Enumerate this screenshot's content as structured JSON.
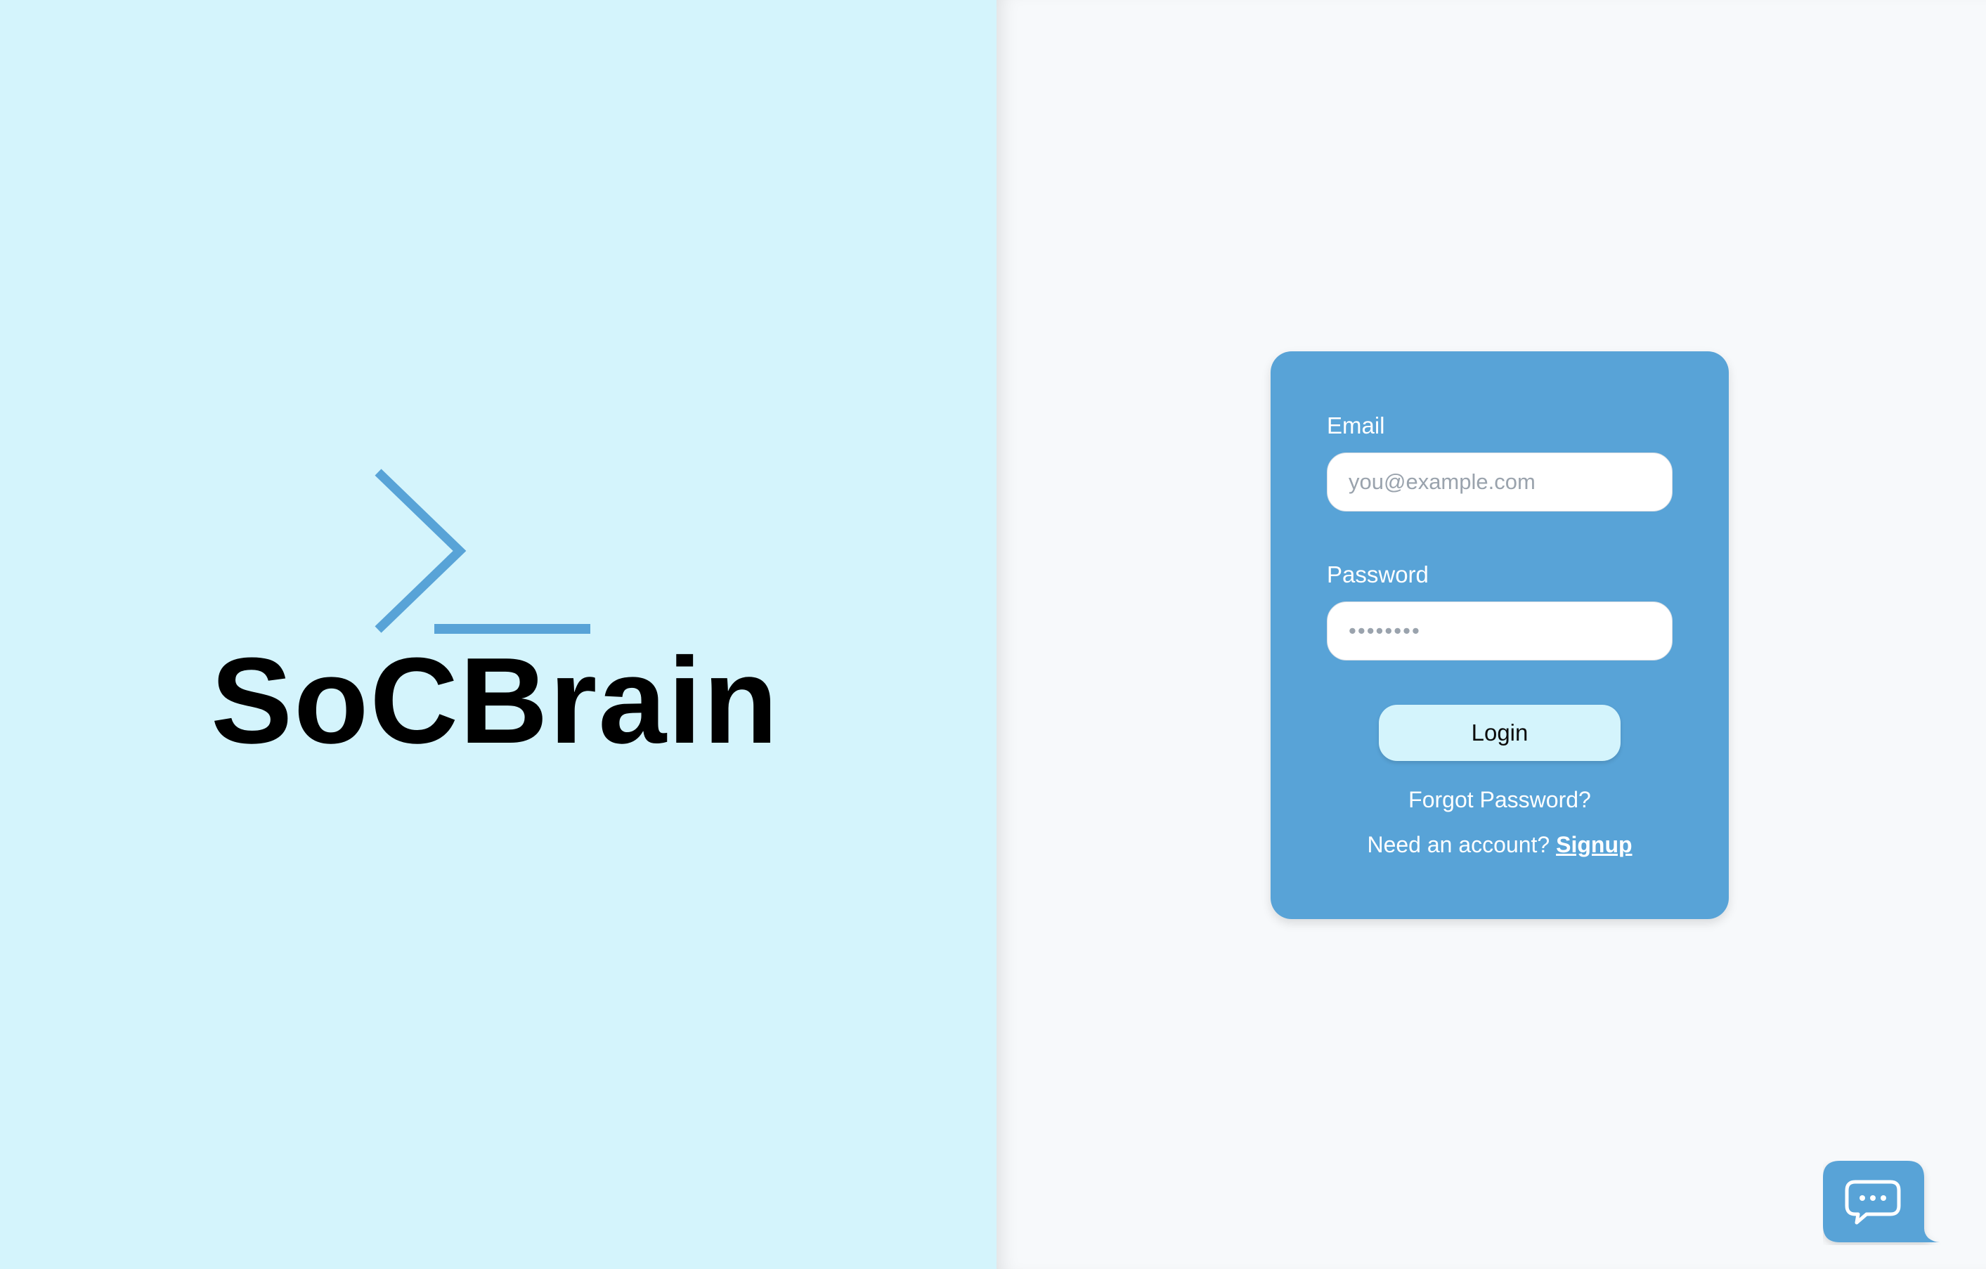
{
  "brand": {
    "name": "SoCBrain",
    "logo_icon": "terminal-prompt-icon"
  },
  "login_form": {
    "email_label": "Email",
    "email_placeholder": "you@example.com",
    "email_value": "",
    "password_label": "Password",
    "password_placeholder": "••••••••",
    "password_value": "",
    "login_label": "Login",
    "forgot_password_label": "Forgot Password?",
    "need_account_text": "Need an account?",
    "signup_label": "Signup"
  },
  "chat_widget": {
    "icon": "chat-bubble-icon"
  },
  "colors": {
    "left_background": "#d4f4fc",
    "right_background": "#f7f9fb",
    "card_background": "#58a3d7",
    "accent": "#58a3d7",
    "button_background": "#d4f4fc"
  }
}
